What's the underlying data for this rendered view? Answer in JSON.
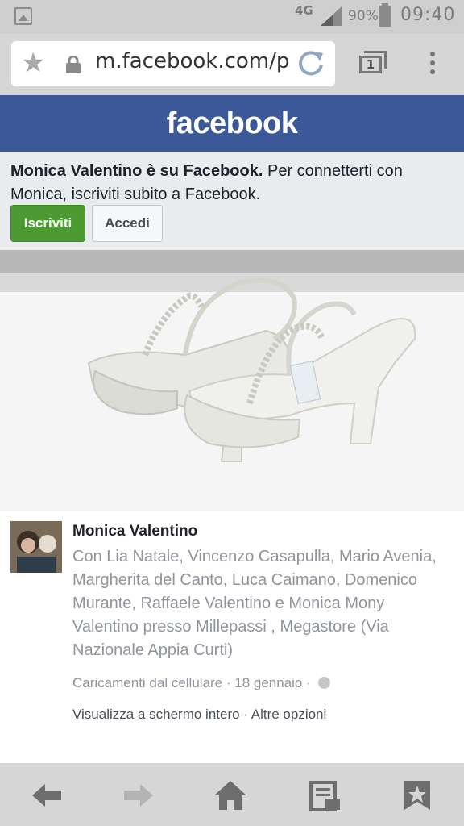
{
  "status_bar": {
    "network": "4G",
    "battery_percent": "90%",
    "time": "09:40"
  },
  "browser": {
    "url": "m.facebook.com/p",
    "tab_count": "1"
  },
  "facebook": {
    "logo_text": "facebook",
    "signup_prompt": {
      "bold_text": "Monica Valentino è su Facebook.",
      "rest_text": " Per connetterti con Monica, iscriviti subito a Facebook."
    },
    "signup_button": "Iscriviti",
    "login_button": "Accedi",
    "brand_color": "#3b5998",
    "signup_color": "#4b9b32"
  },
  "post": {
    "author": "Monica Valentino",
    "tagged_text": "Con Lia Natale, Vincenzo Casapulla, Mario Avenia, Margherita del Canto, Luca Caimano, Domenico Murante, Raffaele Valentino e Monica Mony Valentino presso Millepassi , Megastore (Via Nazionale Appia Curti)",
    "album": "Caricamenti dal cellulare",
    "date": "18 gennaio",
    "fullscreen_link": "Visualizza a schermo intero",
    "options_link": "Altre opzioni"
  },
  "bottom_nav": {
    "icons": [
      "back-arrow-icon",
      "forward-arrow-icon",
      "home-icon",
      "reader-icon",
      "bookmark-icon"
    ]
  }
}
